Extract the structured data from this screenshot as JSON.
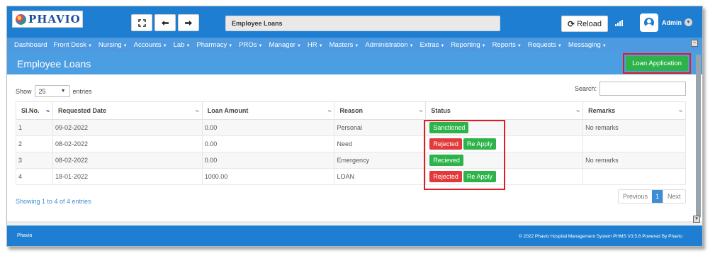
{
  "header": {
    "logo_text": "PHAVIO",
    "fullscreen_icon": "expand-icon",
    "back_icon": "arrow-left-icon",
    "forward_icon": "arrow-right-icon",
    "page_title_box": "Employee Loans",
    "reload_label": "Reload",
    "user_name": "Admin",
    "brand_color": "#1e7fd2"
  },
  "nav": {
    "items": [
      {
        "label": "Dashboard",
        "dropdown": false
      },
      {
        "label": "Front Desk",
        "dropdown": true
      },
      {
        "label": "Nursing",
        "dropdown": true
      },
      {
        "label": "Accounts",
        "dropdown": true
      },
      {
        "label": "Lab",
        "dropdown": true
      },
      {
        "label": "Pharmacy",
        "dropdown": true
      },
      {
        "label": "PROs",
        "dropdown": true
      },
      {
        "label": "Manager",
        "dropdown": true
      },
      {
        "label": "HR",
        "dropdown": true
      },
      {
        "label": "Masters",
        "dropdown": true
      },
      {
        "label": "Administration",
        "dropdown": true
      },
      {
        "label": "Extras",
        "dropdown": true
      },
      {
        "label": "Reporting",
        "dropdown": true
      },
      {
        "label": "Reports",
        "dropdown": true
      },
      {
        "label": "Requests",
        "dropdown": true
      },
      {
        "label": "Messaging",
        "dropdown": true
      }
    ]
  },
  "page": {
    "title": "Employee Loans",
    "loan_application_label": "Loan Application"
  },
  "table_controls": {
    "show_label": "Show",
    "entries_value": "25",
    "entries_label": "entries",
    "search_label": "Search:",
    "search_value": ""
  },
  "table": {
    "columns": [
      "Sl.No.",
      "Requested Date",
      "Loan Amount",
      "Reason",
      "Status",
      "Remarks"
    ],
    "rows": [
      {
        "sl": "1",
        "date": "09-02-2022",
        "amount": "0.00",
        "reason": "Personal",
        "status": [
          {
            "label": "Sanctioned",
            "color": "green"
          }
        ],
        "remarks": "No remarks"
      },
      {
        "sl": "2",
        "date": "08-02-2022",
        "amount": "0.00",
        "reason": "Need",
        "status": [
          {
            "label": "Rejected",
            "color": "red"
          },
          {
            "label": "Re Apply",
            "color": "green"
          }
        ],
        "remarks": ""
      },
      {
        "sl": "3",
        "date": "08-02-2022",
        "amount": "0.00",
        "reason": "Emergency",
        "status": [
          {
            "label": "Recieved",
            "color": "green"
          }
        ],
        "remarks": "No remarks"
      },
      {
        "sl": "4",
        "date": "18-01-2022",
        "amount": "1000.00",
        "reason": "LOAN",
        "status": [
          {
            "label": "Rejected",
            "color": "red"
          },
          {
            "label": "Re Apply",
            "color": "green"
          }
        ],
        "remarks": ""
      }
    ]
  },
  "pagination": {
    "info": "Showing 1 to 4 of 4 entries",
    "previous": "Previous",
    "current": "1",
    "next": "Next"
  },
  "footer": {
    "left": "Phavio",
    "right": "© 2022 Phavio Hospital Management System PHMS V3.5.6 Powered By Phavio"
  }
}
